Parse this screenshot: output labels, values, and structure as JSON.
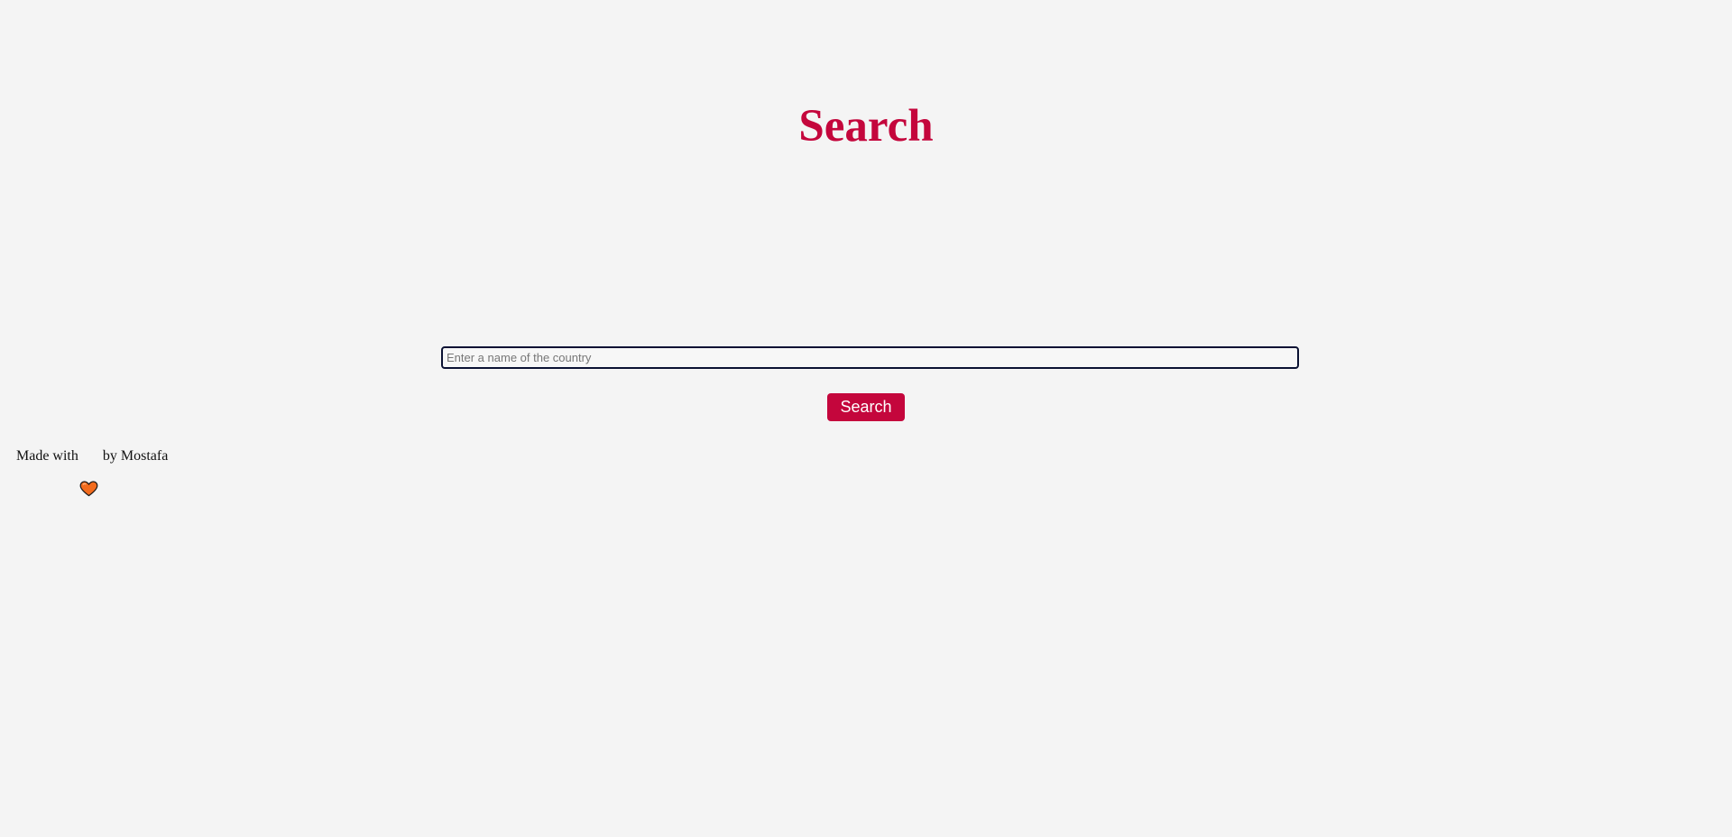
{
  "header": {
    "title": "Search"
  },
  "search": {
    "placeholder": "Enter a name of the country",
    "value": "",
    "button_label": "Search"
  },
  "footer": {
    "prefix": "Made with",
    "icon": "heart-icon",
    "suffix": " by Mostafa"
  },
  "colors": {
    "background": "#f4f4f4",
    "accent": "#c4063c",
    "input_border": "#0b1233",
    "heart": "#f26b1d"
  }
}
